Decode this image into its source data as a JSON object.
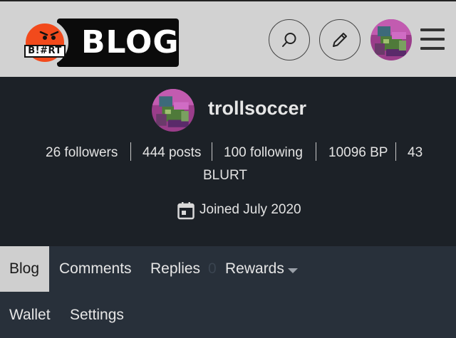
{
  "header": {
    "logo_brand": "B!#RT",
    "logo_text": "BLOG",
    "icons": {
      "search": "search-icon",
      "edit": "pencil-icon",
      "menu": "hamburger-menu-icon"
    }
  },
  "profile": {
    "username": "trollsoccer",
    "stats": {
      "followers": "26 followers",
      "posts": "444 posts",
      "following": "100 following",
      "bp": "10096 BP",
      "blurt_amount": "43",
      "blurt_unit": "BLURT"
    },
    "joined": "Joined July 2020"
  },
  "tabs": {
    "blog": "Blog",
    "comments": "Comments",
    "replies": "Replies",
    "replies_count": "0",
    "rewards": "Rewards",
    "wallet": "Wallet",
    "settings": "Settings"
  },
  "colors": {
    "header_bg": "#d2d2d2",
    "profile_bg": "#1c2127",
    "tabs_bg": "#28303a",
    "logo_accent": "#f24a1c",
    "active_tab_bg": "#cfcfcf"
  }
}
